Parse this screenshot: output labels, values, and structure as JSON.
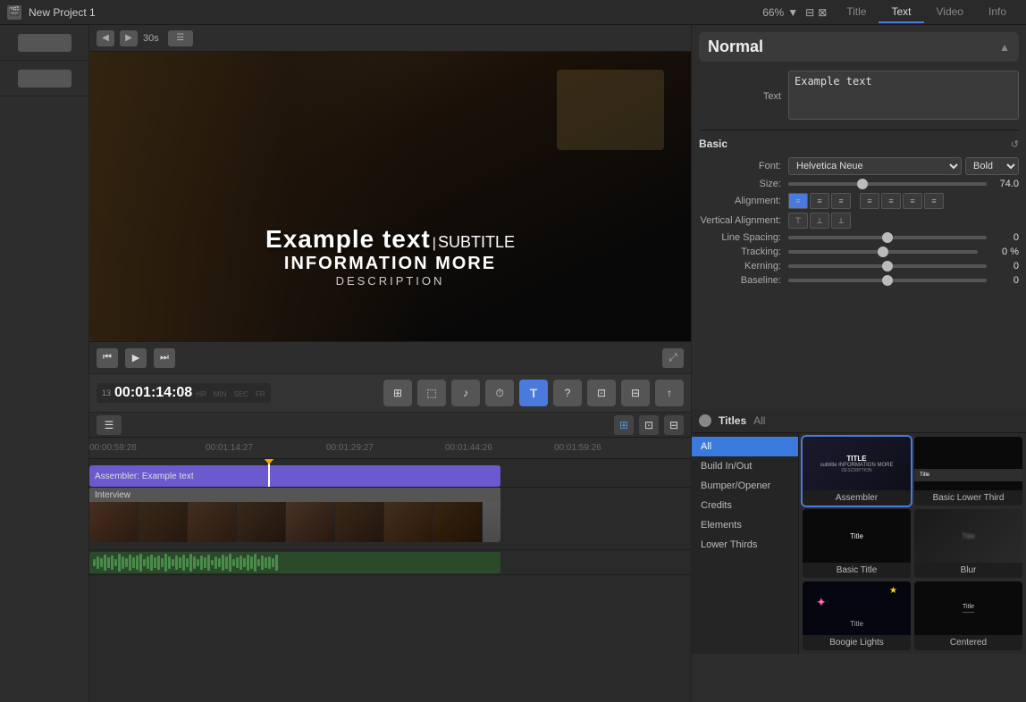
{
  "topbar": {
    "project_icon": "🎬",
    "project_title": "New Project 1",
    "zoom": "66%",
    "tabs": [
      {
        "label": "Title",
        "active": false
      },
      {
        "label": "Text",
        "active": true
      },
      {
        "label": "Video",
        "active": false
      },
      {
        "label": "Info",
        "active": false
      }
    ]
  },
  "preview": {
    "main_text": "Example text",
    "cursor_visible": true,
    "subtitle": "SUBTITLE",
    "info_line": "INFORMATION MORE",
    "description": "DESCRIPTION",
    "timecode": "1:14:08",
    "timecode_labels": {
      "hr": "HR",
      "min": "MIN",
      "sec": "SEC",
      "fr": "FR"
    },
    "frame_num": "13",
    "time_display": "30s"
  },
  "inspector": {
    "style": "Normal",
    "text_section": {
      "label": "Text",
      "placeholder": "Example text"
    },
    "basic_section": {
      "label": "Basic",
      "font": "Helvetica Neue",
      "font_weight": "Bold",
      "size_label": "Size:",
      "size_value": "74.0",
      "alignment_label": "Alignment:",
      "valign_label": "Vertical Alignment:",
      "line_spacing_label": "Line Spacing:",
      "line_spacing_value": "0",
      "tracking_label": "Tracking:",
      "tracking_value": "0",
      "tracking_unit": "%",
      "kerning_label": "Kerning:",
      "kerning_value": "0",
      "baseline_label": "Baseline:"
    }
  },
  "titles_browser": {
    "label": "Titles",
    "all_label": "All",
    "categories": [
      {
        "label": "All",
        "active": true
      },
      {
        "label": "Build In/Out",
        "active": false
      },
      {
        "label": "Bumper/Opener",
        "active": false
      },
      {
        "label": "Credits",
        "active": false
      },
      {
        "label": "Elements",
        "active": false
      },
      {
        "label": "Lower Thirds",
        "active": false
      }
    ],
    "items": [
      {
        "name": "Assembler",
        "selected": true
      },
      {
        "name": "Basic Lower Third",
        "selected": false
      },
      {
        "name": "Basic Title",
        "selected": false
      },
      {
        "name": "Blur",
        "selected": false
      },
      {
        "name": "Boogie Lights",
        "selected": false
      },
      {
        "name": "Centered",
        "selected": false
      }
    ]
  },
  "timeline": {
    "ruler_marks": [
      {
        "time": "00:00:59:28",
        "pos": 0
      },
      {
        "time": "00:01:14:27",
        "pos": 130
      },
      {
        "time": "00:01:29:27",
        "pos": 265
      },
      {
        "time": "00:01:44:26",
        "pos": 398
      },
      {
        "time": "00:01:59:26",
        "pos": 530
      }
    ],
    "clips": [
      {
        "label": "Assembler: Example text",
        "type": "title"
      },
      {
        "label": "Interview",
        "type": "video"
      }
    ]
  },
  "toolbar": {
    "timecode": "00:01:14:08",
    "frame": "13"
  }
}
